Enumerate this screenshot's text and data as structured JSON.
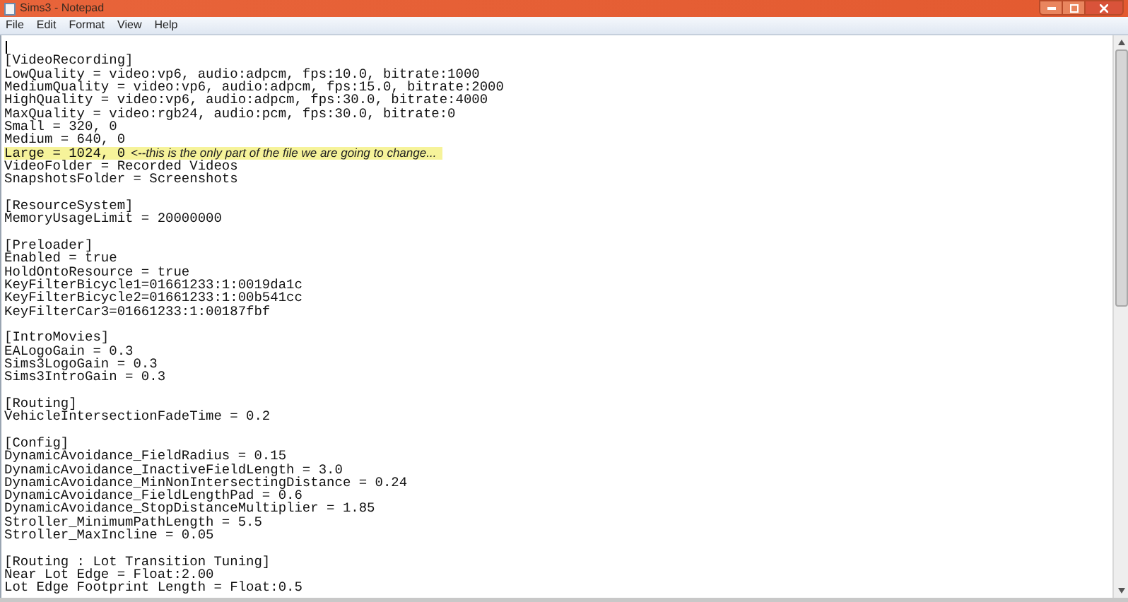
{
  "window": {
    "title": "Sims3 - Notepad"
  },
  "menu": [
    {
      "label": "File"
    },
    {
      "label": "Edit"
    },
    {
      "label": "Format"
    },
    {
      "label": "View"
    },
    {
      "label": "Help"
    }
  ],
  "lines": [
    {
      "kind": "blank",
      "cursor": true
    },
    {
      "kind": "text",
      "text": "[VideoRecording]"
    },
    {
      "kind": "text",
      "text": "LowQuality = video:vp6, audio:adpcm, fps:10.0, bitrate:1000"
    },
    {
      "kind": "text",
      "text": "MediumQuality = video:vp6, audio:adpcm, fps:15.0, bitrate:2000"
    },
    {
      "kind": "text",
      "text": "HighQuality = video:vp6, audio:adpcm, fps:30.0, bitrate:4000"
    },
    {
      "kind": "text",
      "text": "MaxQuality = video:rgb24, audio:pcm, fps:30.0, bitrate:0"
    },
    {
      "kind": "text",
      "text": "Small = 320, 0"
    },
    {
      "kind": "text",
      "text": "Medium = 640, 0"
    },
    {
      "kind": "text",
      "text": "Large = 1024, 0",
      "highlighted": true,
      "note": "<--this is the only part of the file we are going to change..."
    },
    {
      "kind": "text",
      "text": "VideoFolder = Recorded Videos"
    },
    {
      "kind": "text",
      "text": "SnapshotsFolder = Screenshots"
    },
    {
      "kind": "blank"
    },
    {
      "kind": "text",
      "text": "[ResourceSystem]"
    },
    {
      "kind": "text",
      "text": "MemoryUsageLimit = 20000000"
    },
    {
      "kind": "blank"
    },
    {
      "kind": "text",
      "text": "[Preloader]"
    },
    {
      "kind": "text",
      "text": "Enabled = true"
    },
    {
      "kind": "text",
      "text": "HoldOntoResource = true"
    },
    {
      "kind": "text",
      "text": "KeyFilterBicycle1=01661233:1:0019da1c"
    },
    {
      "kind": "text",
      "text": "KeyFilterBicycle2=01661233:1:00b541cc"
    },
    {
      "kind": "text",
      "text": "KeyFilterCar3=01661233:1:00187fbf"
    },
    {
      "kind": "blank"
    },
    {
      "kind": "text",
      "text": "[IntroMovies]"
    },
    {
      "kind": "text",
      "text": "EALogoGain = 0.3"
    },
    {
      "kind": "text",
      "text": "Sims3LogoGain = 0.3"
    },
    {
      "kind": "text",
      "text": "Sims3IntroGain = 0.3"
    },
    {
      "kind": "blank"
    },
    {
      "kind": "text",
      "text": "[Routing]"
    },
    {
      "kind": "text",
      "text": "VehicleIntersectionFadeTime = 0.2"
    },
    {
      "kind": "blank"
    },
    {
      "kind": "text",
      "text": "[Config]"
    },
    {
      "kind": "text",
      "text": "DynamicAvoidance_FieldRadius = 0.15"
    },
    {
      "kind": "text",
      "text": "DynamicAvoidance_InactiveFieldLength = 3.0"
    },
    {
      "kind": "text",
      "text": "DynamicAvoidance_MinNonIntersectingDistance = 0.24"
    },
    {
      "kind": "text",
      "text": "DynamicAvoidance_FieldLengthPad = 0.6"
    },
    {
      "kind": "text",
      "text": "DynamicAvoidance_StopDistanceMultiplier = 1.85"
    },
    {
      "kind": "text",
      "text": "Stroller_MinimumPathLength = 5.5"
    },
    {
      "kind": "text",
      "text": "Stroller_MaxIncline = 0.05"
    },
    {
      "kind": "blank"
    },
    {
      "kind": "text",
      "text": "[Routing : Lot Transition Tuning]"
    },
    {
      "kind": "text",
      "text": "Near Lot Edge = Float:2.00"
    },
    {
      "kind": "text",
      "text": "Lot Edge Footprint Length = Float:0.5"
    }
  ]
}
